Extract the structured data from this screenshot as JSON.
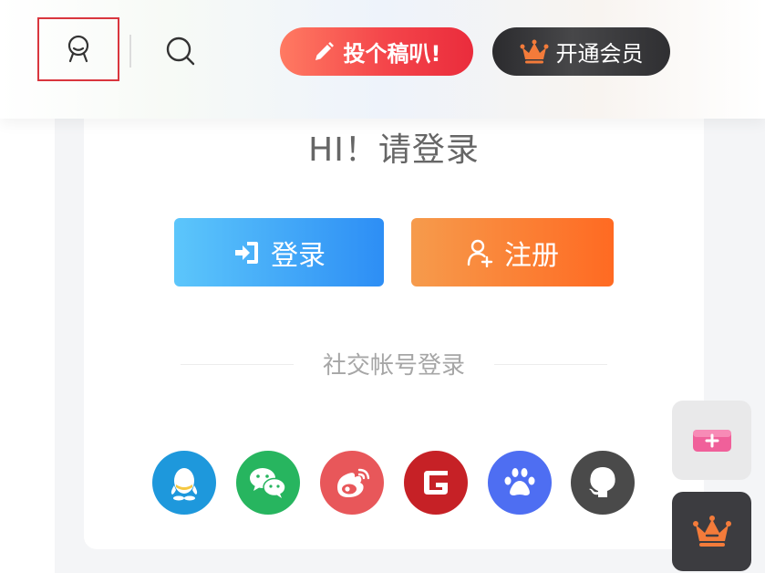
{
  "header": {
    "user_icon": "user-icon",
    "search_icon": "search-icon",
    "contribute_label": "投个稿叭!",
    "contribute_icon": "pencil-icon",
    "vip_label": "开通会员",
    "vip_icon": "crown-icon"
  },
  "card": {
    "greeting": "HI！请登录",
    "login_label": "登录",
    "register_label": "注册",
    "social_title": "社交帐号登录",
    "social": [
      {
        "name": "qq-icon",
        "color": "#1e98dc"
      },
      {
        "name": "wechat-icon",
        "color": "#27b55f"
      },
      {
        "name": "weibo-icon",
        "color": "#e8575a"
      },
      {
        "name": "gitee-icon",
        "color": "#c62126"
      },
      {
        "name": "baidu-icon",
        "color": "#4e6ef2"
      },
      {
        "name": "github-icon",
        "color": "#4a4a4a"
      }
    ]
  },
  "floating": {
    "post_icon": "add-post-icon",
    "vip_icon": "crown-icon"
  },
  "colors": {
    "highlight_border": "#d9363e",
    "login_gradient": [
      "#5cc6fb",
      "#2d8ef5"
    ],
    "register_gradient": [
      "#f69b4c",
      "#ff6a22"
    ],
    "contribute_gradient": [
      "#ff7a62",
      "#ea2c3c"
    ]
  }
}
